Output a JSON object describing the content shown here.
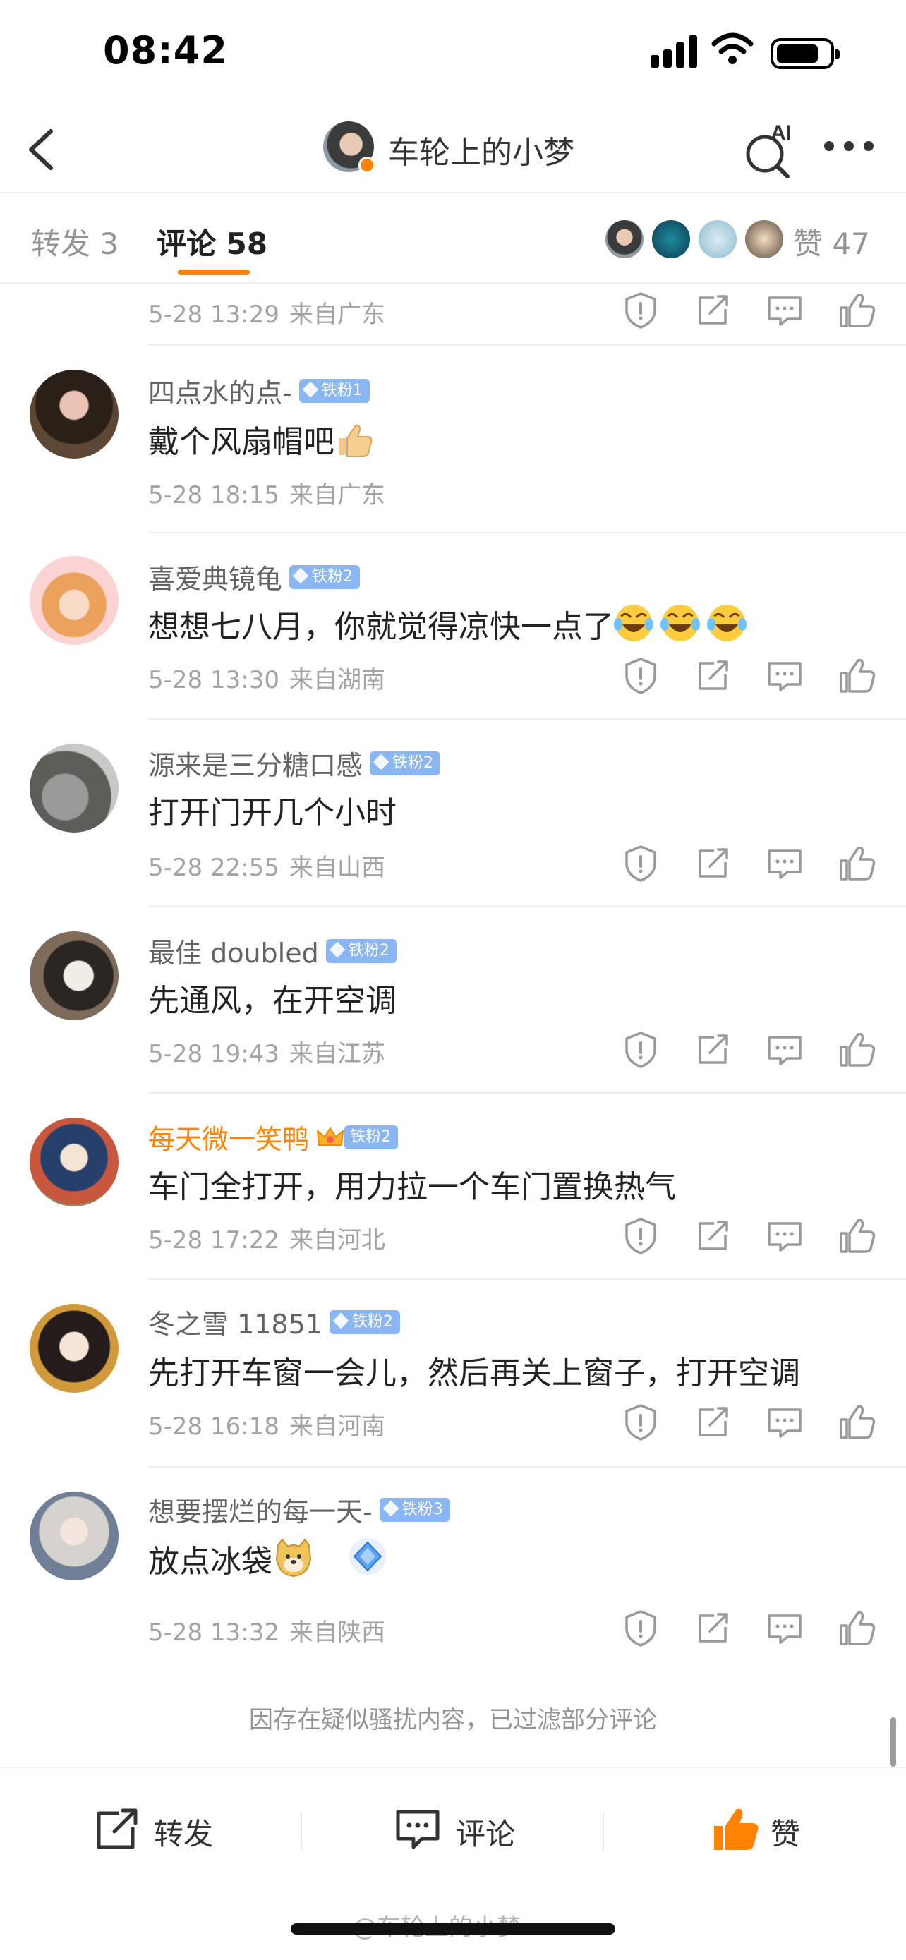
{
  "status_bar": {
    "time": "08:42"
  },
  "nav": {
    "title": "车轮上的小梦",
    "ai_label": "AI"
  },
  "tabs": {
    "repost": "转发 3",
    "comments": "评论 58",
    "likes": "赞 47"
  },
  "comments": [
    {
      "name": "",
      "text": "",
      "date": "5-28 13:29",
      "location": "来自广东",
      "partial": true
    },
    {
      "name": "四点水的点-",
      "badge": "铁粉1",
      "text": "戴个风扇帽吧",
      "emoji": "thumbs-up-emoji",
      "date": "5-28 18:15",
      "location": "来自广东",
      "actions": false
    },
    {
      "name": "喜爱典镜龟",
      "badge": "铁粉2",
      "text": "想想七八月，你就觉得凉快一点了",
      "emoji": "laughing-tears-emoji-x3",
      "date": "5-28 13:30",
      "location": "来自湖南"
    },
    {
      "name": "源来是三分糖口感",
      "badge": "铁粉2",
      "text": "打开门开几个小时",
      "date": "5-28 22:55",
      "location": "来自山西"
    },
    {
      "name": "最佳 doubled",
      "badge": "铁粉2",
      "text": "先通风，在开空调",
      "date": "5-28 19:43",
      "location": "来自江苏"
    },
    {
      "name": "每天微一笑鸭",
      "badge": "铁粉2",
      "vip": true,
      "text": "车门全打开，用力拉一个车门置换热气",
      "date": "5-28 17:22",
      "location": "来自河北"
    },
    {
      "name": "冬之雪 11851",
      "badge": "铁粉2",
      "text": "先打开车窗一会儿，然后再关上窗子，打开空调",
      "date": "5-28 16:18",
      "location": "来自河南"
    },
    {
      "name": "想要摆烂的每一天-",
      "badge": "铁粉3",
      "text": "放点冰袋",
      "emoji": "doge-emoji",
      "date": "5-28 13:32",
      "location": "来自陕西"
    }
  ],
  "filter_note": "因存在疑似骚扰内容，已过滤部分评论",
  "bottom_bar": {
    "repost": "转发",
    "comment": "评论",
    "like": "赞"
  },
  "watermark": "@车轮上的小梦",
  "colors": {
    "accent": "#ff8200",
    "badge_blue": "#8ab7f3",
    "text_gray": "#a3a3a3",
    "vip_name": "#ff8200"
  }
}
